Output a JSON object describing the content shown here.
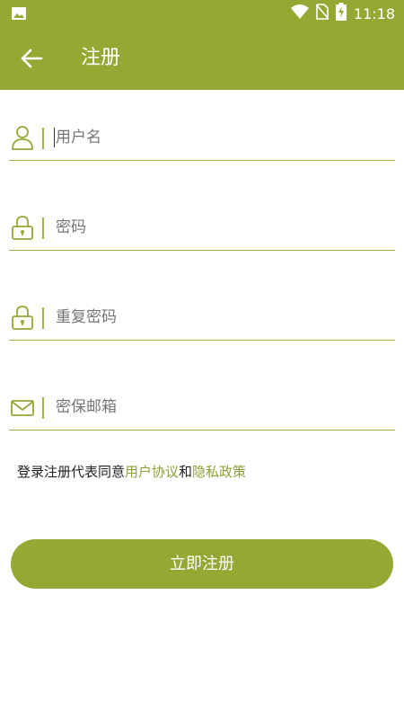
{
  "status_bar": {
    "time": "11:18",
    "icons": [
      "image-icon",
      "wifi-icon",
      "no-sim-icon",
      "battery-charging-icon"
    ]
  },
  "app_bar": {
    "back_icon": "arrow-left-icon",
    "title": "注册"
  },
  "form": {
    "username": {
      "placeholder": "用户名",
      "icon": "user-icon"
    },
    "password": {
      "placeholder": "密码",
      "icon": "lock-icon"
    },
    "confirm_password": {
      "placeholder": "重复密码",
      "icon": "lock-icon"
    },
    "secure_email": {
      "placeholder": "密保邮箱",
      "icon": "mail-icon"
    }
  },
  "agreement": {
    "prefix": "登录注册代表同意",
    "user_agreement": "用户协议",
    "conjunction": "和",
    "privacy_policy": "隐私政策"
  },
  "submit_label": "立即注册",
  "colors": {
    "primary": "#96a834",
    "link": "#8aa035",
    "hint": "#9a9a9a",
    "underline": "#9fb046"
  }
}
